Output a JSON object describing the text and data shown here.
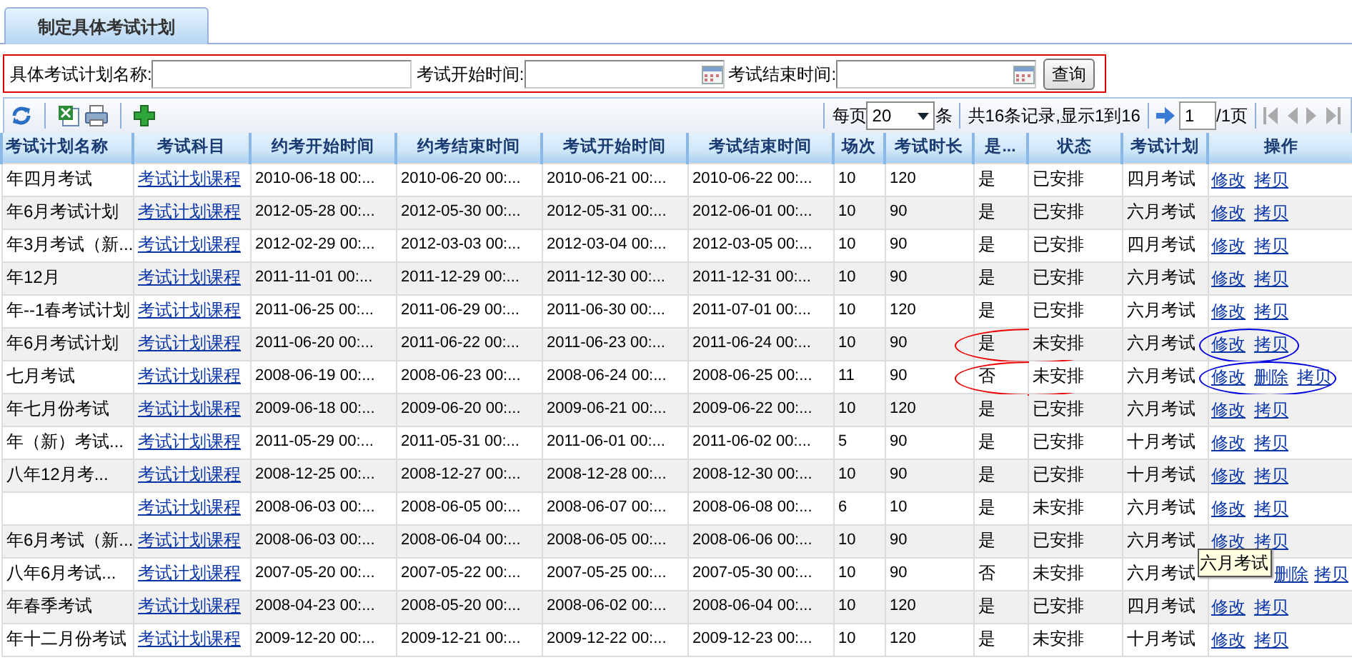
{
  "tab": {
    "label": "制定具体考试计划",
    "selected": true
  },
  "filters": [
    {
      "label": "具体考试计划名称:",
      "kind": "text"
    },
    {
      "label": "考试开始时间:",
      "kind": "date"
    },
    {
      "label": "考试结束时间:",
      "kind": "date"
    }
  ],
  "search_button": "查询",
  "pager": {
    "per_page_label": "每页",
    "per_page": "20",
    "unit": "条",
    "summary": "共16条记录,显示1到16",
    "page": "1",
    "total_pages": "/1页"
  },
  "table": {
    "columns": [
      "考试计划名称",
      "考试科目",
      "约考开始时间",
      "约考结束时间",
      "考试开始时间",
      "考试结束时间",
      "场次",
      "考试时长",
      "是...",
      "状态",
      "考试计划",
      "操作"
    ],
    "rows": [
      {
        "name": "年四月考试",
        "subject": "考试计划课程",
        "book_start": "2010-06-18 00:...",
        "book_end": "2010-06-20 00:...",
        "exam_start": "2010-06-21 00:...",
        "exam_end": "2010-06-22 00:...",
        "sessions": "10",
        "duration": "120",
        "flag": "是",
        "status": "已安排",
        "plan": "四月考试",
        "actions": [
          "修改",
          "拷贝"
        ],
        "circled": false
      },
      {
        "name": "年6月考试计划",
        "subject": "考试计划课程",
        "book_start": "2012-05-28 00:...",
        "book_end": "2012-05-30 00:...",
        "exam_start": "2012-05-31 00:...",
        "exam_end": "2012-06-01 00:...",
        "sessions": "10",
        "duration": "90",
        "flag": "是",
        "status": "已安排",
        "plan": "六月考试",
        "actions": [
          "修改",
          "拷贝"
        ],
        "circled": false
      },
      {
        "name": "年3月考试（新...",
        "subject": "考试计划课程",
        "book_start": "2012-02-29 00:...",
        "book_end": "2012-03-03 00:...",
        "exam_start": "2012-03-04 00:...",
        "exam_end": "2012-03-05 00:...",
        "sessions": "10",
        "duration": "90",
        "flag": "是",
        "status": "已安排",
        "plan": "四月考试",
        "actions": [
          "修改",
          "拷贝"
        ],
        "circled": false
      },
      {
        "name": "年12月",
        "subject": "考试计划课程",
        "book_start": "2011-11-01 00:...",
        "book_end": "2011-12-29 00:...",
        "exam_start": "2011-12-30 00:...",
        "exam_end": "2011-12-31 00:...",
        "sessions": "10",
        "duration": "90",
        "flag": "是",
        "status": "已安排",
        "plan": "六月考试",
        "actions": [
          "修改",
          "拷贝"
        ],
        "circled": false
      },
      {
        "name": "年--1春考试计划",
        "subject": "考试计划课程",
        "book_start": "2011-06-25 00:...",
        "book_end": "2011-06-29 00:...",
        "exam_start": "2011-06-30 00:...",
        "exam_end": "2011-07-01 00:...",
        "sessions": "10",
        "duration": "120",
        "flag": "是",
        "status": "已安排",
        "plan": "六月考试",
        "actions": [
          "修改",
          "拷贝"
        ],
        "circled": false
      },
      {
        "name": "年6月考试计划",
        "subject": "考试计划课程",
        "book_start": "2011-06-20 00:...",
        "book_end": "2011-06-22 00:...",
        "exam_start": "2011-06-23 00:...",
        "exam_end": "2011-06-24 00:...",
        "sessions": "10",
        "duration": "90",
        "flag": "是",
        "status": "未安排",
        "plan": "六月考试",
        "actions": [
          "修改",
          "拷贝"
        ],
        "circled": true
      },
      {
        "name": "七月考试",
        "subject": "考试计划课程",
        "book_start": "2008-06-19 00:...",
        "book_end": "2008-06-23 00:...",
        "exam_start": "2008-06-24 00:...",
        "exam_end": "2008-06-25 00:...",
        "sessions": "11",
        "duration": "90",
        "flag": "否",
        "status": "未安排",
        "plan": "六月考试",
        "actions": [
          "修改",
          "删除",
          "拷贝"
        ],
        "circled": true
      },
      {
        "name": "年七月份考试",
        "subject": "考试计划课程",
        "book_start": "2009-06-18 00:...",
        "book_end": "2009-06-20 00:...",
        "exam_start": "2009-06-21 00:...",
        "exam_end": "2009-06-22 00:...",
        "sessions": "10",
        "duration": "120",
        "flag": "是",
        "status": "已安排",
        "plan": "六月考试",
        "actions": [
          "修改",
          "拷贝"
        ],
        "circled": false
      },
      {
        "name": "年（新）考试...",
        "subject": "考试计划课程",
        "book_start": "2011-05-29 00:...",
        "book_end": "2011-05-31 00:...",
        "exam_start": "2011-06-01 00:...",
        "exam_end": "2011-06-02 00:...",
        "sessions": "5",
        "duration": "90",
        "flag": "是",
        "status": "已安排",
        "plan": "十月考试",
        "actions": [
          "修改",
          "拷贝"
        ],
        "circled": false
      },
      {
        "name": "八年12月考...",
        "subject": "考试计划课程",
        "book_start": "2008-12-25 00:...",
        "book_end": "2008-12-27 00:...",
        "exam_start": "2008-12-28 00:...",
        "exam_end": "2008-12-30 00:...",
        "sessions": "10",
        "duration": "90",
        "flag": "是",
        "status": "已安排",
        "plan": "十月考试",
        "actions": [
          "修改",
          "拷贝"
        ],
        "circled": false
      },
      {
        "subject": "考试计划课程",
        "book_start": "2008-06-03 00:...",
        "book_end": "2008-06-05 00:...",
        "exam_start": "2008-06-07 00:...",
        "exam_end": "2008-06-08 00:...",
        "sessions": "6",
        "duration": "10",
        "flag": "是",
        "status": "未安排",
        "plan": "六月考试",
        "actions": [
          "修改",
          "拷贝"
        ],
        "circled": false
      },
      {
        "name": "年6月考试（新...",
        "subject": "考试计划课程",
        "book_start": "2008-06-03 00:...",
        "book_end": "2008-06-04 00:...",
        "exam_start": "2008-06-05 00:...",
        "exam_end": "2008-06-06 00:...",
        "sessions": "10",
        "duration": "90",
        "flag": "是",
        "status": "已安排",
        "plan": "六月考试",
        "actions": [
          "修改",
          "拷贝"
        ],
        "circled": false
      },
      {
        "name": "八年6月考试...",
        "subject": "考试计划课程",
        "book_start": "2007-05-20 00:...",
        "book_end": "2007-05-22 00:...",
        "exam_start": "2007-05-25 00:...",
        "exam_end": "2007-05-30 00:...",
        "sessions": "10",
        "duration": "90",
        "flag": "否",
        "status": "未安排",
        "plan": "六月考试",
        "actions": [
          "删除",
          "拷贝"
        ],
        "circled": false,
        "tooltip": "六月考试"
      },
      {
        "name": "年春季考试",
        "subject": "考试计划课程",
        "book_start": "2008-04-23 00:...",
        "book_end": "2008-05-20 00:...",
        "exam_start": "2008-06-02 00:...",
        "exam_end": "2008-06-04 00:...",
        "sessions": "10",
        "duration": "120",
        "flag": "是",
        "status": "已安排",
        "plan": "四月考试",
        "actions": [
          "修改",
          "拷贝"
        ],
        "circled": false
      },
      {
        "name": "年十二月份考试",
        "subject": "考试计划课程",
        "book_start": "2009-12-20 00:...",
        "book_end": "2009-12-21 00:...",
        "exam_start": "2009-12-22 00:...",
        "exam_end": "2009-12-23 00:...",
        "sessions": "10",
        "duration": "120",
        "flag": "是",
        "status": "未安排",
        "plan": "十月考试",
        "actions": [
          "修改",
          "拷贝"
        ],
        "circled": false
      }
    ]
  }
}
